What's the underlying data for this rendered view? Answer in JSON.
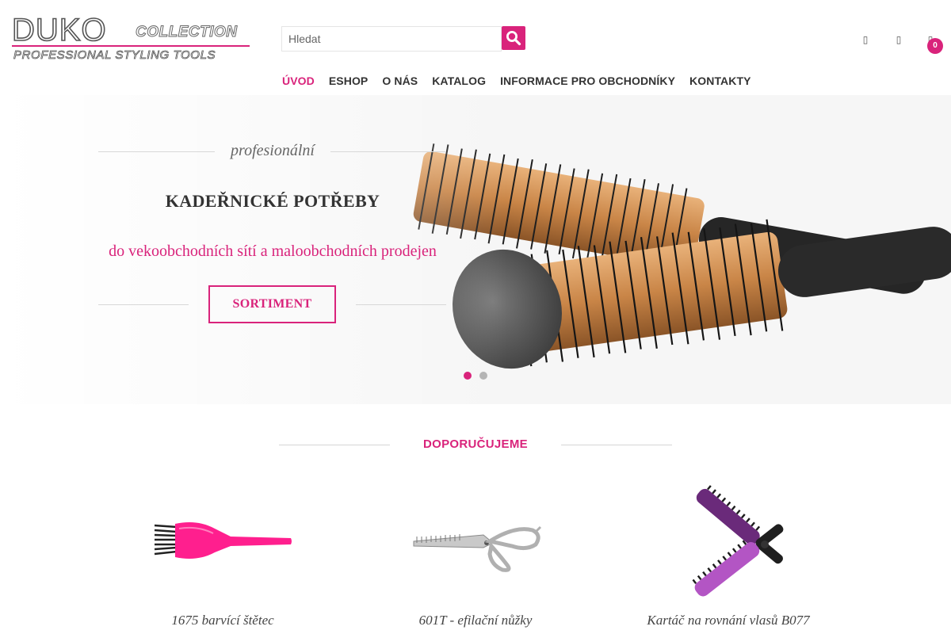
{
  "brand": {
    "logo_main": "DUKO",
    "logo_collection": "COLLECTION",
    "logo_tagline": "PROFESSIONAL STYLING TOOLS",
    "accent_color": "#d9237b"
  },
  "search": {
    "placeholder": "Hledat",
    "button_icon": "search-icon"
  },
  "header_icons": [
    "user-icon",
    "heart-icon",
    "cart-icon"
  ],
  "cart": {
    "count": "0"
  },
  "nav": {
    "items": [
      {
        "label": "ÚVOD",
        "active": true
      },
      {
        "label": "ESHOP",
        "active": false
      },
      {
        "label": "O NÁS",
        "active": false
      },
      {
        "label": "KATALOG",
        "active": false
      },
      {
        "label": "INFORMACE PRO OBCHODNÍKY",
        "active": false
      },
      {
        "label": "KONTAKTY",
        "active": false
      }
    ]
  },
  "hero": {
    "eyebrow": "profesionální",
    "title": "KADEŘNICKÉ POTŘEBY",
    "subtitle": "do vekoobchodních sítí a maloobchodních prodejen",
    "cta_label": "SORTIMENT",
    "slides": 2,
    "active_slide": 1
  },
  "recommend": {
    "title": "DOPORUČUJEME",
    "products": [
      {
        "name": "1675 barvící štětec",
        "image": "tint-brush"
      },
      {
        "name": "601T - efilační nůžky",
        "image": "thinning-scissors"
      },
      {
        "name": "Kartáč na rovnání vlasů B077",
        "image": "straightening-brush"
      }
    ]
  }
}
